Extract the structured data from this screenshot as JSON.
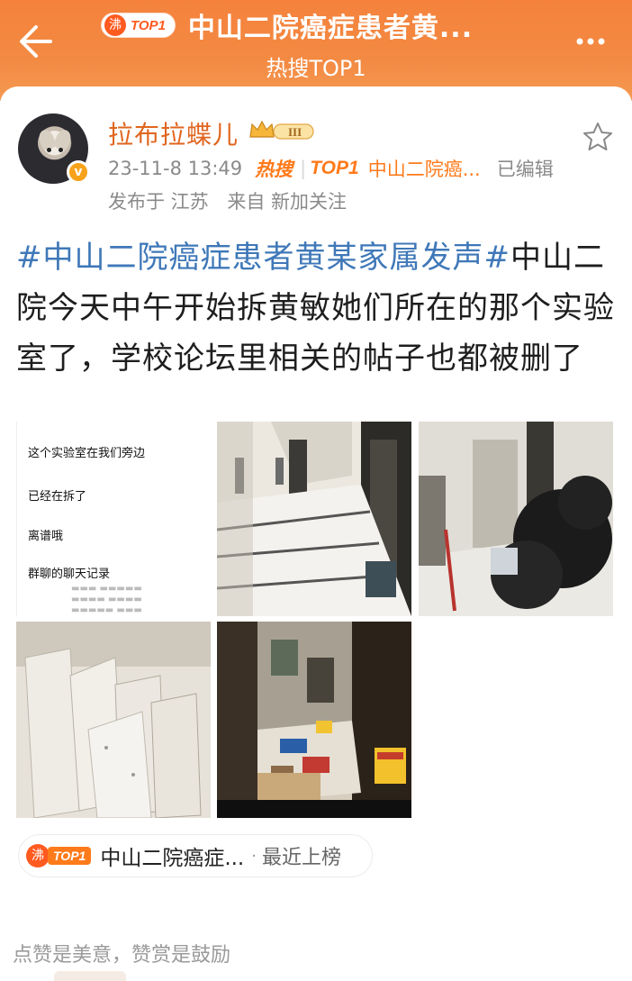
{
  "header": {
    "badge_fei": "沸",
    "badge_top": "TOP1",
    "title": "中山二院癌症患者黄...",
    "subtitle": "热搜TOP1"
  },
  "author": {
    "name": "拉布拉蝶儿",
    "level_badge": "III",
    "time": "23-11-8 13:49",
    "hot_label": "热搜",
    "top_label": "TOP1",
    "topic_short": "中山二院癌...",
    "edited": "已编辑",
    "location": "发布于 江苏",
    "source": "来自 新加关注"
  },
  "post": {
    "topic": "#中山二院癌症患者黄某家属发声#",
    "text": "中山二院今天中午开始拆黄敏她们所在的那个实验室了，学校论坛里相关的帖子也都被删了"
  },
  "screenshot_text": {
    "line1": "这个实验室在我们旁边",
    "line2": "已经在拆了",
    "line3": "离谱哦",
    "line4": "群聊的聊天记录"
  },
  "topic_pill": {
    "fei": "沸",
    "top": "TOP1",
    "name": "中山二院癌症...",
    "dot": "·",
    "status": "最近上榜"
  },
  "footer": {
    "note": "点赞是美意，赞赏是鼓励"
  },
  "colors": {
    "header_orange": "#f4823c",
    "topic_blue": "#3f78b8",
    "username_orange": "#e0651f",
    "hot_orange": "#ff7a1a"
  }
}
